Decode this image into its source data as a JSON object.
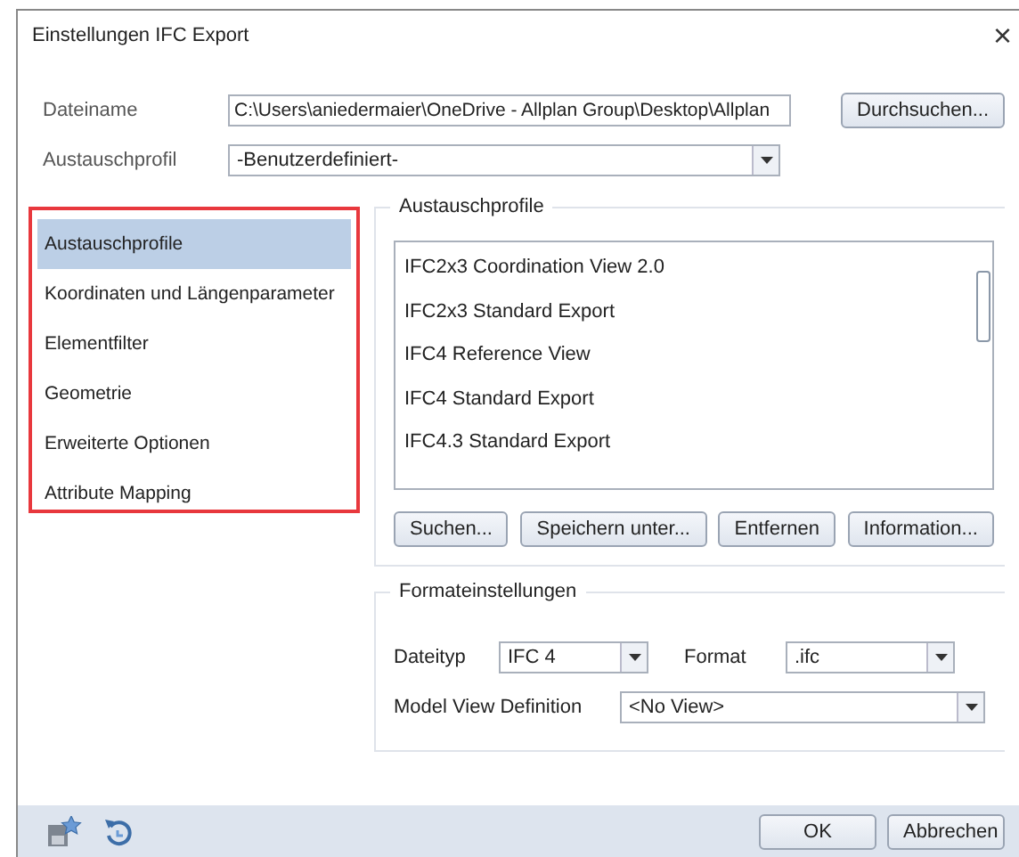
{
  "window": {
    "title": "Einstellungen IFC Export",
    "close": "×"
  },
  "file": {
    "label": "Dateiname",
    "value": "C:\\Users\\aniedermaier\\OneDrive - Allplan Group\\Desktop\\Allplan",
    "browse": "Durchsuchen..."
  },
  "profile": {
    "label": "Austauschprofil",
    "value": "-Benutzerdefiniert-"
  },
  "sidebar": {
    "items": [
      {
        "label": "Austauschprofile",
        "selected": true
      },
      {
        "label": "Koordinaten und Längenparameter",
        "selected": false
      },
      {
        "label": "Elementfilter",
        "selected": false
      },
      {
        "label": "Geometrie",
        "selected": false
      },
      {
        "label": "Erweiterte Optionen",
        "selected": false
      },
      {
        "label": "Attribute Mapping",
        "selected": false
      }
    ]
  },
  "profiles": {
    "title": "Austauschprofile",
    "items": [
      {
        "label": "IFC2x3 Coordination View 2.0",
        "selected": false
      },
      {
        "label": "IFC2x3 Standard Export",
        "selected": false
      },
      {
        "label": "IFC4 Reference View",
        "selected": false
      },
      {
        "label": "IFC4 Standard Export",
        "selected": false
      },
      {
        "label": "IFC4.3 Standard Export",
        "selected": false
      }
    ],
    "buttons": [
      "Suchen...",
      "Speichern unter...",
      "Entfernen",
      "Information..."
    ]
  },
  "format": {
    "title": "Formateinstellungen",
    "filetype_label": "Dateityp",
    "filetype": "IFC 4",
    "format_label": "Format",
    "format": ".ifc",
    "mvd_label": "Model View Definition",
    "mvd": "<No View>"
  },
  "footer": {
    "buttons": [
      "OK",
      "Abbrechen"
    ]
  }
}
